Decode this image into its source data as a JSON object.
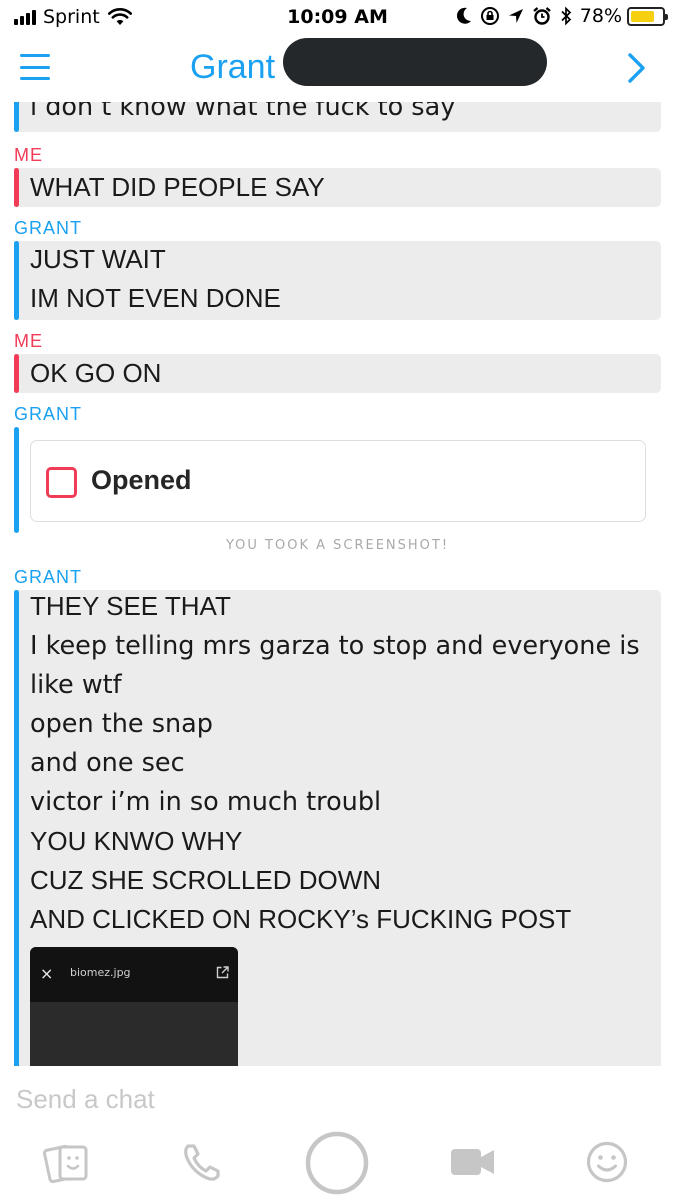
{
  "status_bar": {
    "carrier": "Sprint",
    "time": "10:09 AM",
    "battery_percent": "78%",
    "battery_level": 0.78,
    "icons": [
      "signal-icon",
      "wifi-icon",
      "moon-icon",
      "rotation-lock-icon",
      "location-icon",
      "alarm-icon",
      "bluetooth-icon",
      "battery-icon"
    ]
  },
  "header": {
    "title": "Grant",
    "left_icon": "menu-icon",
    "right_icon": "chevron-right-icon"
  },
  "messages": {
    "m0": {
      "text": "i don’t know what the fuck to say"
    },
    "m1": {
      "sender": "ME",
      "text": "WHAT DID PEOPLE SAY"
    },
    "m2": {
      "sender": "GRANT",
      "lines": [
        "JUST WAIT",
        "IM NOT EVEN DONE"
      ]
    },
    "m3": {
      "sender": "ME",
      "text": "OK GO ON"
    },
    "m4": {
      "sender": "GRANT",
      "snap_status": "Opened"
    },
    "system_note": "YOU TOOK A SCREENSHOT!",
    "m5": {
      "sender": "GRANT",
      "lines": [
        "THEY SEE THAT",
        "I keep telling mrs garza to stop and everyone is",
        "like wtf",
        "open the snap",
        "and one sec",
        "victor i’m in so much troubl",
        "YOU KNWO WHY",
        "CUZ SHE SCROLLED DOWN",
        "AND CLICKED ON ROCKY’s FUCKING POST"
      ],
      "attachment": {
        "close": "×",
        "filename": "biomez.jpg"
      }
    }
  },
  "composer": {
    "placeholder": "Send a chat",
    "buttons": [
      "stickers-icon",
      "phone-icon",
      "capture-button",
      "video-camera-icon",
      "emoji-icon"
    ]
  },
  "colors": {
    "accent_blue": "#1aa1f1",
    "me_red": "#f23c57",
    "bubble_bg": "#ececec"
  }
}
